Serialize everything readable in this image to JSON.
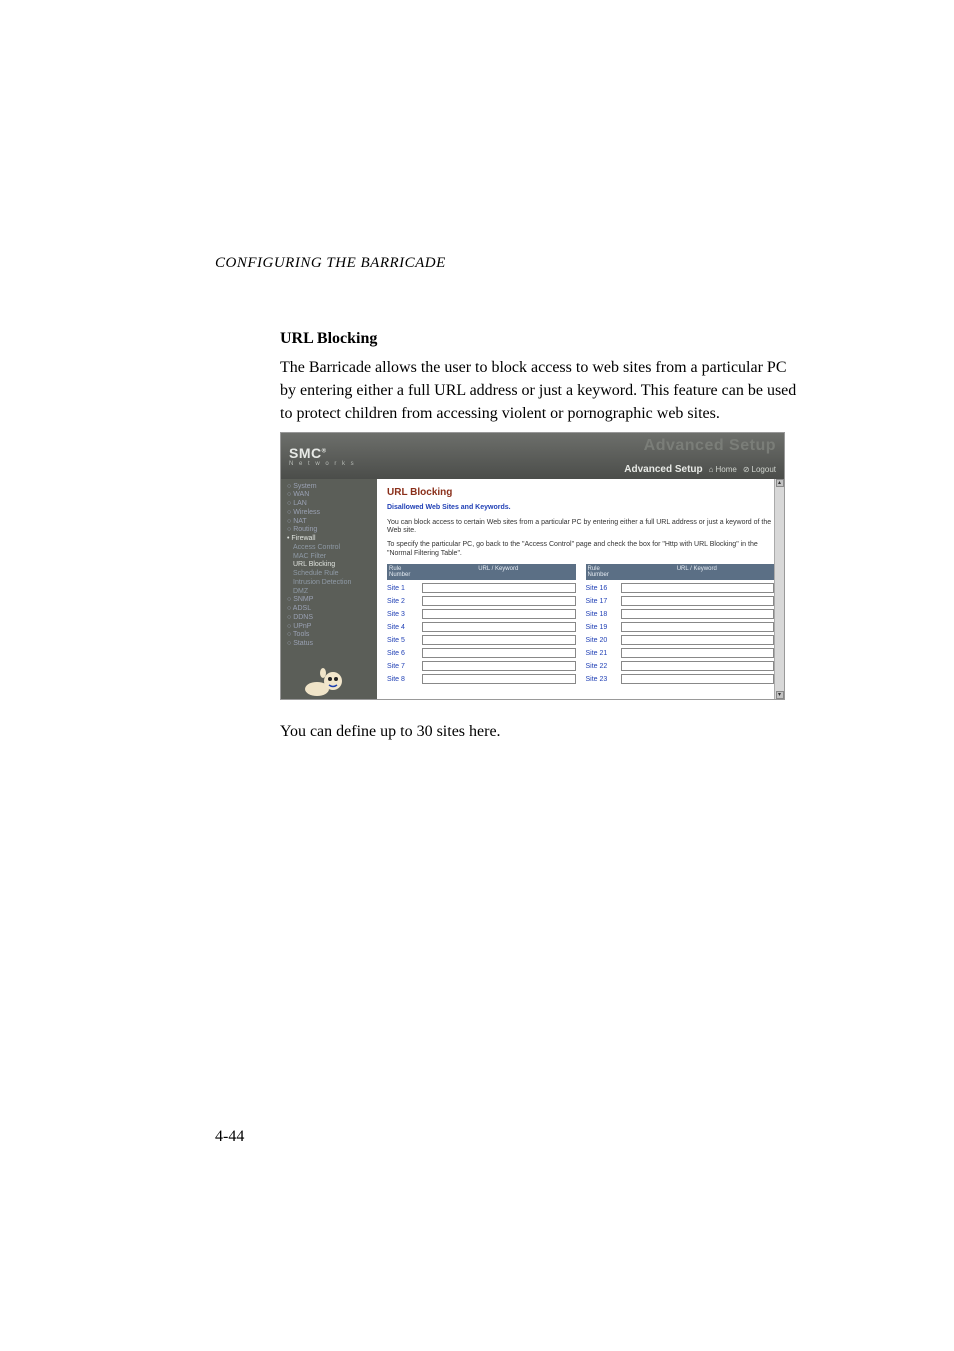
{
  "header": "CONFIGURING THE BARRICADE",
  "section_title": "URL Blocking",
  "body_paragraph": "The Barricade allows the user to block access to web sites from a particular PC by entering either a full URL address or just a keyword. This feature can be used to protect children from accessing violent or pornographic web sites.",
  "note": "You can define up to 30 sites here.",
  "page_number": "4-44",
  "screenshot": {
    "logo_main": "SMC",
    "logo_sub": "N e t w o r k s",
    "top_ghost": "Advanced Setup",
    "top_setup": "Advanced Setup",
    "top_home": "Home",
    "top_logout": "Logout",
    "sidebar": {
      "items": [
        {
          "label": "System",
          "cls": "top"
        },
        {
          "label": "WAN",
          "cls": "top"
        },
        {
          "label": "LAN",
          "cls": "top"
        },
        {
          "label": "Wireless",
          "cls": "top"
        },
        {
          "label": "NAT",
          "cls": "top"
        },
        {
          "label": "Routing",
          "cls": "top"
        },
        {
          "label": "Firewall",
          "cls": "sel"
        },
        {
          "label": "Access Control",
          "cls": "sub"
        },
        {
          "label": "MAC Filter",
          "cls": "sub"
        },
        {
          "label": "URL Blocking",
          "cls": "sub sel"
        },
        {
          "label": "Schedule Rule",
          "cls": "sub"
        },
        {
          "label": "Intrusion Detection",
          "cls": "sub"
        },
        {
          "label": "DMZ",
          "cls": "sub"
        },
        {
          "label": "SNMP",
          "cls": "top"
        },
        {
          "label": "ADSL",
          "cls": "top"
        },
        {
          "label": "DDNS",
          "cls": "top"
        },
        {
          "label": "UPnP",
          "cls": "top"
        },
        {
          "label": "Tools",
          "cls": "top"
        },
        {
          "label": "Status",
          "cls": "top"
        }
      ]
    },
    "main": {
      "heading": "URL Blocking",
      "subheading": "Disallowed Web Sites and Keywords.",
      "para1": "You can block access to certain Web sites from a particular PC by entering either a full URL address or just a keyword of the Web site.",
      "para2": "To specify the particular PC, go back to the \"Access Control\" page and check the box for \"Http with URL Blocking\" in the \"Normal Filtering Table\".",
      "th_num": "Rule Number",
      "th_url": "URL / Keyword",
      "left_rows": [
        "Site 1",
        "Site 2",
        "Site 3",
        "Site 4",
        "Site 5",
        "Site 6",
        "Site 7",
        "Site 8"
      ],
      "right_rows": [
        "Site 16",
        "Site 17",
        "Site 18",
        "Site 19",
        "Site 20",
        "Site 21",
        "Site 22",
        "Site 23"
      ]
    }
  }
}
